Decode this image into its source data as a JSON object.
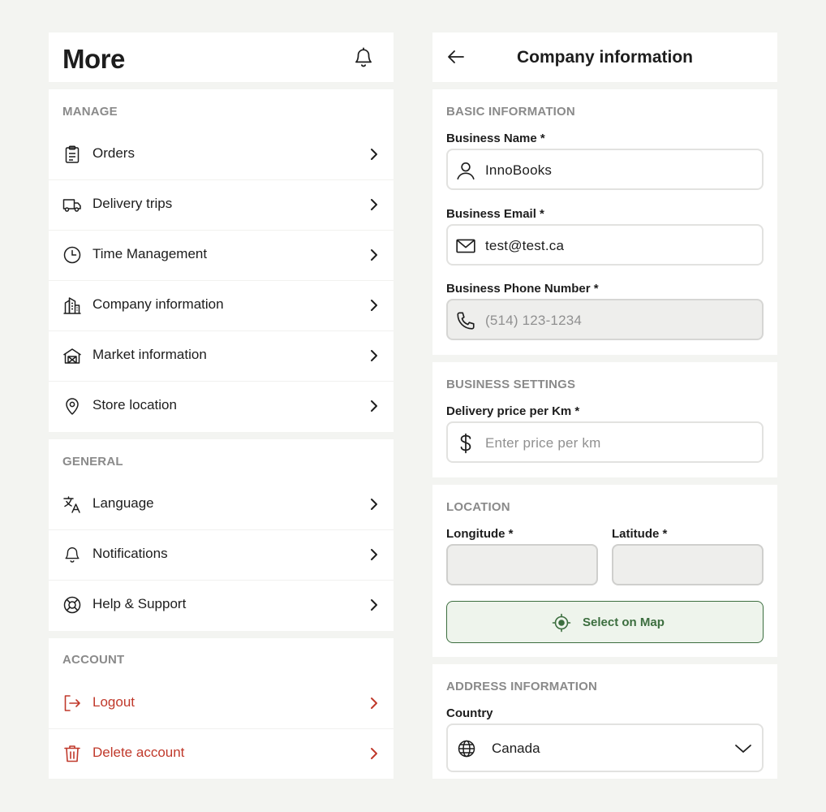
{
  "more": {
    "title": "More",
    "manage": {
      "heading": "MANAGE",
      "items": [
        {
          "label": "Orders",
          "icon": "clipboard-icon"
        },
        {
          "label": "Delivery trips",
          "icon": "truck-icon"
        },
        {
          "label": "Time Management",
          "icon": "clock-icon"
        },
        {
          "label": "Company information",
          "icon": "building-icon"
        },
        {
          "label": "Market information",
          "icon": "warehouse-icon"
        },
        {
          "label": "Store location",
          "icon": "map-pin-icon"
        }
      ]
    },
    "general": {
      "heading": "GENERAL",
      "items": [
        {
          "label": "Language",
          "icon": "translate-icon"
        },
        {
          "label": "Notifications",
          "icon": "bell-icon"
        },
        {
          "label": "Help & Support",
          "icon": "lifebuoy-icon"
        }
      ]
    },
    "account": {
      "heading": "ACCOUNT",
      "items": [
        {
          "label": "Logout",
          "icon": "logout-icon"
        },
        {
          "label": "Delete account",
          "icon": "trash-icon"
        }
      ]
    }
  },
  "company": {
    "title": "Company information",
    "basic": {
      "heading": "BASIC INFORMATION",
      "business_name_label": "Business Name *",
      "business_name_value": "InnoBooks",
      "business_email_label": "Business Email *",
      "business_email_value": "test@test.ca",
      "business_phone_label": "Business Phone Number *",
      "business_phone_placeholder": "(514) 123-1234"
    },
    "settings": {
      "heading": "BUSINESS SETTINGS",
      "delivery_price_label": "Delivery price per Km *",
      "delivery_price_placeholder": "Enter price per km"
    },
    "location": {
      "heading": "LOCATION",
      "longitude_label": "Longitude *",
      "latitude_label": "Latitude *",
      "longitude_value": "",
      "latitude_value": "",
      "select_on_map_label": "Select on Map"
    },
    "address": {
      "heading": "ADDRESS INFORMATION",
      "country_label": "Country",
      "country_value": "Canada"
    }
  },
  "colors": {
    "background": "#f3f4f1",
    "card": "#ffffff",
    "muted_text": "#8a8a8a",
    "danger": "#c0392b",
    "accent_green": "#3c6e3f",
    "accent_green_bg": "#eef4ec",
    "disabled_bg": "#eeeeec"
  }
}
